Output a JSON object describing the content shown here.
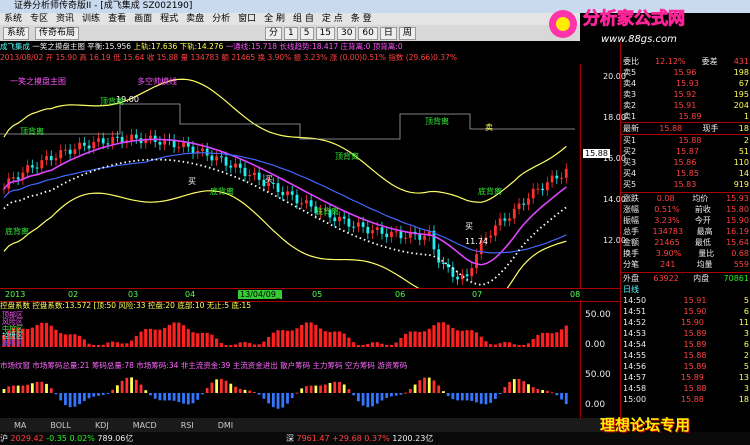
{
  "window": {
    "title": "证券分析师传奇版II - [成飞集成 SZ002190]"
  },
  "menu": [
    "系统",
    "专区",
    "资讯",
    "训练",
    "查看",
    "画面",
    "程式",
    "卖盘",
    "分析",
    "窗口",
    "全 刷",
    "组 自",
    "定 点",
    "条 登"
  ],
  "toolbar": {
    "home_label": "系统",
    "back_label": "传奇布局",
    "period_labels": [
      "分",
      "1",
      "5",
      "15",
      "30",
      "60",
      "日",
      "周"
    ]
  },
  "chart_header": {
    "name": "成飞集成",
    "formula": "一笑之摸盘主图",
    "ping_heng": "平衡:15.956",
    "shang_gui": "上轨:17.636",
    "xia_gui": "下轨:14.276",
    "extra": "一通线:15.718  长线趋势:18.417  庄背离:0  顶背离:0",
    "date_line": "2013/08/02  开 15.90  高 16.19  低 15.64  收 15.88  量 134783  额 21465  换 3.90%  振 3.23%  涨 (0.00)0.51%  指数 (29.66)0.37%"
  },
  "annotations": {
    "dingbeili": "顶背离",
    "dibeili": "底背离",
    "buy": "买",
    "sell": "卖",
    "duokong": "多空帅模线",
    "high_label": "19.00",
    "low_label": "11.74",
    "yixiao": "一笑之摸盘主图"
  },
  "yaxis": {
    "ticks": [
      "20.00",
      "18.00",
      "16.00",
      "14.00",
      "12.00"
    ],
    "current": "15.88"
  },
  "xaxis": {
    "labels": [
      "2013",
      "02",
      "03",
      "04",
      "13/04/09_",
      "05",
      "06",
      "07",
      "08"
    ]
  },
  "indicator1": {
    "header": "控盘系数 控盘系数:13.572 [顶:50 风险:33 控盘:20 底部:10 无止:5 底:15",
    "levels": [
      "顶部区",
      "风险区",
      "中控区",
      "控盘区",
      "底部区"
    ],
    "ymax": "50.00",
    "ymid": "0.00"
  },
  "indicator2": {
    "header": "市场纹窗  市场筹码总量:21 筹码总量:78 市场筹码:34 非主流资金:39 主流资金进出 散户筹码 主力筹码 空方筹码 游资筹码",
    "ymax": "50.00",
    "ymid": "0.00"
  },
  "bottom_tabs": [
    "MA",
    "BOLL",
    "KDJ",
    "MACD",
    "RSI",
    "DMI"
  ],
  "status": {
    "sh_label": "沪",
    "sh_value": "2029.42",
    "sh_change": "-0.35",
    "sh_pct": "0.02%",
    "sh_amount": "789.06亿",
    "sz_label": "深",
    "sz_value": "7961.47",
    "sz_change": "+29.68",
    "sz_pct": "0.37%",
    "sz_amount": "1200.23亿"
  },
  "quote": {
    "weibi_label": "委比",
    "weibi": "12.12%",
    "weicha_label": "委差",
    "weicha": "431",
    "sells": [
      {
        "label": "卖5",
        "price": "15.96",
        "vol": "198"
      },
      {
        "label": "卖4",
        "price": "15.93",
        "vol": "67"
      },
      {
        "label": "卖3",
        "price": "15.92",
        "vol": "195"
      },
      {
        "label": "卖2",
        "price": "15.91",
        "vol": "204"
      },
      {
        "label": "卖1",
        "price": "15.89",
        "vol": "1"
      }
    ],
    "latest": {
      "label": "最新",
      "price": "15.88",
      "vol_label": "现手",
      "vol": "18"
    },
    "buys": [
      {
        "label": "买1",
        "price": "15.88",
        "vol": "2"
      },
      {
        "label": "买2",
        "price": "15.87",
        "vol": "51"
      },
      {
        "label": "买3",
        "price": "15.86",
        "vol": "110"
      },
      {
        "label": "买4",
        "price": "15.85",
        "vol": "14"
      },
      {
        "label": "买5",
        "price": "15.83",
        "vol": "919"
      }
    ],
    "stats": [
      {
        "k1": "涨跌",
        "v1": "0.08",
        "k2": "均价",
        "v2": "15.93"
      },
      {
        "k1": "涨幅",
        "v1": "0.51%",
        "k2": "前收",
        "v2": "15.80"
      },
      {
        "k1": "振幅",
        "v1": "3.23%",
        "k2": "今开",
        "v2": "15.90"
      },
      {
        "k1": "总手",
        "v1": "134783",
        "k2": "最高",
        "v2": "16.19"
      },
      {
        "k1": "金额",
        "v1": "21465",
        "k2": "最低",
        "v2": "15.64"
      },
      {
        "k1": "换手",
        "v1": "3.90%",
        "k2": "量比",
        "v2": "0.68"
      },
      {
        "k1": "分笔",
        "v1": "241",
        "k2": "均量",
        "v2": "559"
      }
    ],
    "waipan_label": "外盘",
    "waipan": "63922",
    "neipan_label": "内盘",
    "neipan": "70861",
    "tab_label": "日线",
    "ticks": [
      {
        "t": "14:50",
        "p": "15.91",
        "v": "5"
      },
      {
        "t": "14:51",
        "p": "15.90",
        "v": "6"
      },
      {
        "t": "14:52",
        "p": "15.90",
        "v": "11"
      },
      {
        "t": "14:53",
        "p": "15.89",
        "v": "3"
      },
      {
        "t": "14:54",
        "p": "15.89",
        "v": "6"
      },
      {
        "t": "14:55",
        "p": "15.88",
        "v": "2"
      },
      {
        "t": "14:56",
        "p": "15.89",
        "v": "5"
      },
      {
        "t": "14:57",
        "p": "15.89",
        "v": "13"
      },
      {
        "t": "14:58",
        "p": "15.88",
        "v": "3"
      },
      {
        "t": "15:00",
        "p": "15.88",
        "v": "18"
      }
    ]
  },
  "logo": {
    "text": "分析家公式网",
    "url": "www.88gs.com"
  },
  "watermark": "理想论坛专用",
  "colors": {
    "up": "#ff3030",
    "down": "#22ee22",
    "boll": "#ffff66",
    "ma": "#ff55ff",
    "accent": "#ffee00"
  }
}
